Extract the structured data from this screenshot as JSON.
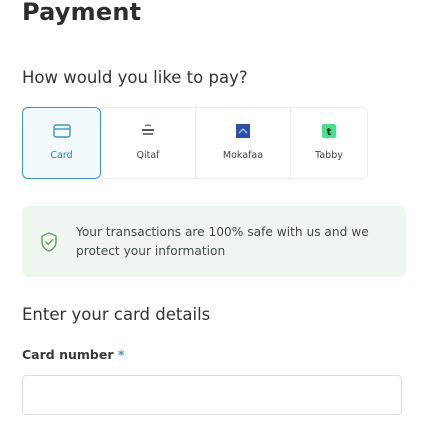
{
  "page": {
    "title": "Payment"
  },
  "payment": {
    "question": "How would you like to pay?",
    "methods": [
      {
        "label": "Card",
        "icon": "credit-card-icon",
        "selected": true
      },
      {
        "label": "Qitaf",
        "icon": "qitaf-logo-icon"
      },
      {
        "label": "Mokafaa",
        "icon": "mokafaa-logo-icon"
      },
      {
        "label": "Tabby",
        "icon": "tabby-logo-icon"
      }
    ]
  },
  "notice": {
    "text": "Your transactions are 100% safe with us and we protect your information",
    "icon": "shield-check-icon"
  },
  "card_details": {
    "title": "Enter your card details",
    "card_number_label": "Card number",
    "required_mark": "*",
    "card_number_value": ""
  },
  "colors": {
    "accent": "#3e97b8",
    "notice_bg": "#eef6ef",
    "tabby_green": "#3ee58c",
    "mokafaa_blue": "#2c4fa8"
  }
}
